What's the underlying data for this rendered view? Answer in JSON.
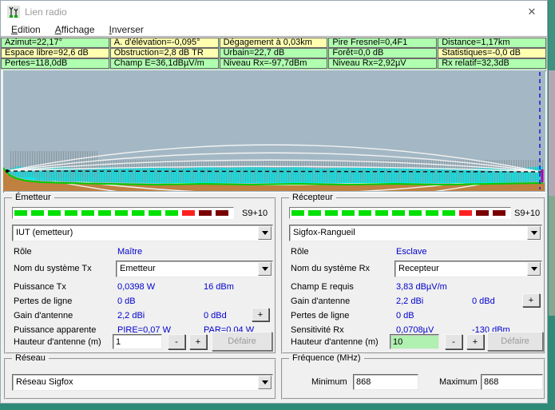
{
  "window": {
    "title": "Lien radio",
    "close_glyph": "✕"
  },
  "menu": {
    "items": [
      "Edition",
      "Affichage",
      "Inverser"
    ]
  },
  "header": {
    "rows": [
      {
        "cells": [
          {
            "text": "Azimut=22,17°",
            "bg": "#b0ffb0"
          },
          {
            "text": "A. d'élévation=-0,095°",
            "bg": "#ffffb0"
          },
          {
            "text": "Dégagement à 0,03km",
            "bg": "#ffffb0"
          },
          {
            "text": "Pire Fresnel=0,4F1",
            "bg": "#b0ffb0"
          },
          {
            "text": "Distance=1,17km",
            "bg": "#b0ffb0"
          }
        ]
      },
      {
        "cells": [
          {
            "text": "Espace libre=92,6 dB",
            "bg": "#ffffb0"
          },
          {
            "text": "Obstruction=2,8 dB TR",
            "bg": "#ffffb0"
          },
          {
            "text": "Urbain=22,7 dB",
            "bg": "#b0ffb0"
          },
          {
            "text": "Forêt=0,0 dB",
            "bg": "#b0ffb0"
          },
          {
            "text": "Statistiques=-0,0 dB",
            "bg": "#ffffb0"
          }
        ]
      },
      {
        "cells": [
          {
            "text": "Pertes=118,0dB",
            "bg": "#b0ffb0"
          },
          {
            "text": "Champ E=36,1dBµV/m",
            "bg": "#b0ffb0"
          },
          {
            "text": "Niveau Rx=-97,7dBm",
            "bg": "#b0ffb0"
          },
          {
            "text": "Niveau Rx=2,92µV",
            "bg": "#b0ffb0"
          },
          {
            "text": "Rx relatif=32,3dB",
            "bg": "#b0ffb0"
          }
        ]
      }
    ]
  },
  "chart": {
    "colors": {
      "sky": "#a3b8c4",
      "ground": "#c08040",
      "urban_fill": "#00e8e8",
      "clutter": "#88959c",
      "terrain_line": "#00cc00",
      "fresnel": "#f2f2f2",
      "los_line": "#111111",
      "cursor_line": "#2020dd",
      "rx_marker": "#aa00aa"
    }
  },
  "meter": {
    "label": "S9+10",
    "segment_colors": {
      "g": "#00e000",
      "r": "#ff2020",
      "d": "#7a0000"
    },
    "emitter_segments": [
      "g",
      "g",
      "g",
      "g",
      "g",
      "g",
      "g",
      "g",
      "g",
      "g",
      "r",
      "d",
      "d"
    ],
    "receiver_segments": [
      "g",
      "g",
      "g",
      "g",
      "g",
      "g",
      "g",
      "g",
      "g",
      "g",
      "r",
      "d",
      "d"
    ]
  },
  "emitter": {
    "title": "Émetteur",
    "station": "IUT (emetteur)",
    "role_label": "Rôle",
    "role_value": "Maître",
    "system_label": "Nom du système Tx",
    "system_value": "Emetteur",
    "rows": [
      {
        "label": "Puissance Tx",
        "v1": "0,0398 W",
        "v2": "16 dBm"
      },
      {
        "label": "Pertes de ligne",
        "v1": "0 dB",
        "v2": ""
      },
      {
        "label": "Gain d'antenne",
        "v1": "2,2 dBi",
        "v2": "0 dBd"
      },
      {
        "label": "Puissance apparente",
        "v1": "PIRE=0,07 W",
        "v2": "PAR=0,04 W"
      }
    ],
    "plus_label": "+",
    "height_label": "Hauteur d'antenne (m)",
    "height_value": "1",
    "minus_label": "-",
    "undo_label": "Défaire"
  },
  "receiver": {
    "title": "Récepteur",
    "station": "Sigfox-Rangueil",
    "role_label": "Rôle",
    "role_value": "Esclave",
    "system_label": "Nom du système Rx",
    "system_value": "Recepteur",
    "rows": [
      {
        "label": "Champ E requis",
        "v1": "3,83 dBµV/m",
        "v2": ""
      },
      {
        "label": "Gain d'antenne",
        "v1": "2,2 dBi",
        "v2": "0 dBd"
      },
      {
        "label": "Pertes de ligne",
        "v1": "0 dB",
        "v2": ""
      },
      {
        "label": "Sensitivité Rx",
        "v1": "0,0708µV",
        "v2": "-130 dBm"
      }
    ],
    "plus_label": "+",
    "height_label": "Hauteur d'antenne (m)",
    "height_value": "10",
    "height_bg": "#b0f0b0",
    "minus_label": "-",
    "undo_label": "Défaire"
  },
  "network": {
    "title": "Réseau",
    "value": "Réseau Sigfox"
  },
  "frequency": {
    "title": "Fréquence (MHz)",
    "min_label": "Minimum",
    "min_value": "868",
    "max_label": "Maximum",
    "max_value": "868"
  }
}
